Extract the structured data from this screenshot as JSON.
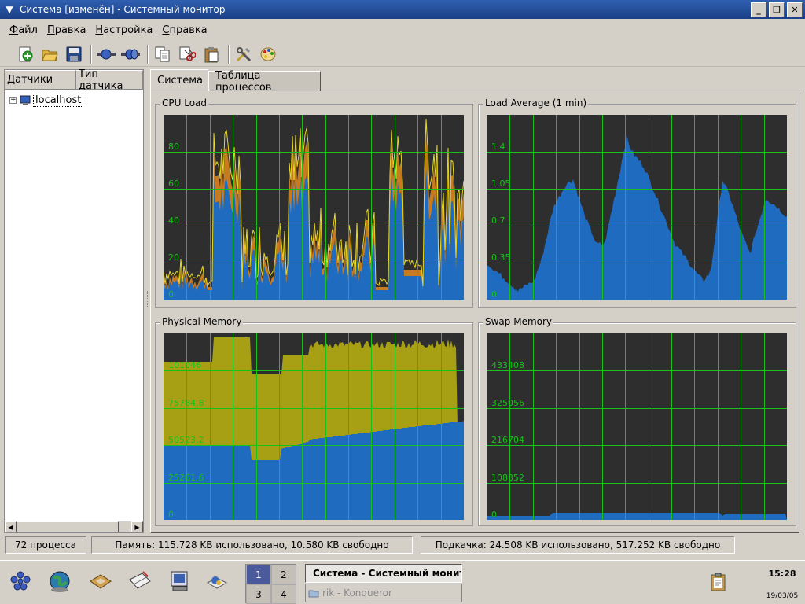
{
  "window": {
    "title": "Система [изменён] - Системный монитор",
    "buttons": [
      "minimize",
      "maximize",
      "close"
    ]
  },
  "menu": [
    "Файл",
    "Правка",
    "Настройка",
    "Справка"
  ],
  "toolbar_icons": [
    "new-icon",
    "open-folder-icon",
    "save-icon",
    "connect-host-icon",
    "disconnect-host-icon",
    "copy-icon",
    "cut-icon",
    "paste-icon",
    "configure-icon",
    "style-icon"
  ],
  "sensor_tree": {
    "columns": [
      "Датчики",
      "Тип датчика"
    ],
    "items": [
      {
        "label": "localhost",
        "expander": "+"
      }
    ]
  },
  "tabs": [
    "Система",
    "Таблица процессов"
  ],
  "graphs": {
    "cpu": {
      "title": "CPU Load",
      "ticks": [
        "80",
        "60",
        "40",
        "20",
        "0"
      ]
    },
    "load": {
      "title": "Load Average (1 min)",
      "ticks": [
        "1.4",
        "1.05",
        "0.7",
        "0.35",
        "0"
      ]
    },
    "mem": {
      "title": "Physical Memory",
      "ticks": [
        "101046",
        "75784.8",
        "50523.2",
        "25261.6",
        "0"
      ]
    },
    "swap": {
      "title": "Swap Memory",
      "ticks": [
        "433408",
        "325056",
        "216704",
        "108352",
        "0"
      ]
    }
  },
  "colors": {
    "graph_bg": "#2e2e2e",
    "grid": "#19c019",
    "series_blue": "#1e6bbf",
    "series_yellow": "#a8a014",
    "series_orange": "#c87a1e",
    "series_line_yellow": "#e8d820"
  },
  "status": {
    "processes": "72 процесса",
    "memory": "Память: 115.728 KB использовано, 10.580 KB свободно",
    "swap": "Подкачка: 24.508 KB использовано, 517.252 KB свободно"
  },
  "taskbar": {
    "pager": [
      "1",
      "2",
      "3",
      "4"
    ],
    "current_desktop": "1",
    "tasks": [
      {
        "label": "Система - Системный монитор",
        "active": true
      },
      {
        "label": "rik - Konqueror",
        "active": false
      }
    ],
    "clock": "15:28",
    "date": "19/03/05"
  }
}
